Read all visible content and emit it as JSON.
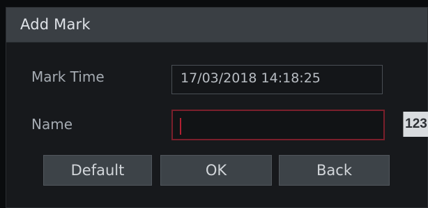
{
  "dialog": {
    "title": "Add Mark",
    "mark_time": {
      "label": "Mark Time",
      "value": "17/03/2018 14:18:25"
    },
    "name": {
      "label": "Name",
      "value": ""
    },
    "ime_toggle": "123",
    "buttons": {
      "default": "Default",
      "ok": "OK",
      "back": "Back"
    }
  },
  "colors": {
    "titlebar": "#3a3f44",
    "background": "#17191c",
    "focus_border": "#7a1f2b",
    "button": "#3d4348"
  }
}
